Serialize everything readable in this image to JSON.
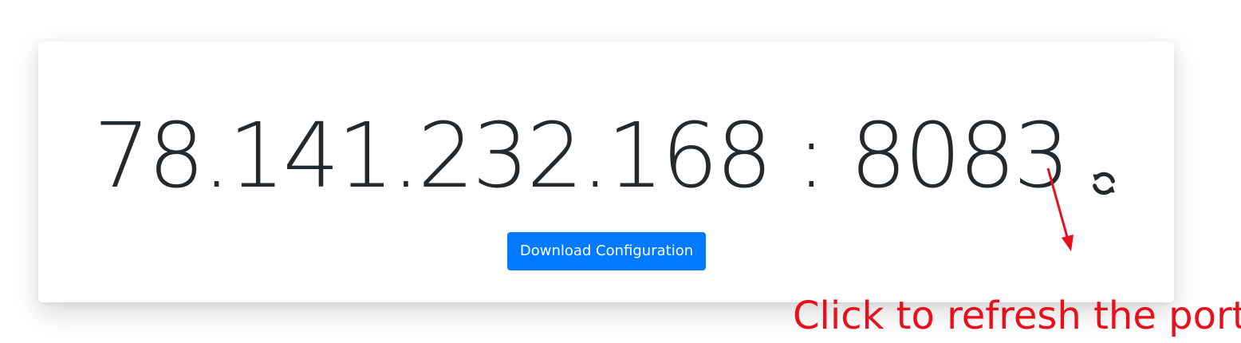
{
  "connection": {
    "address": "78.141.232.168 : 8083",
    "refresh_icon": "refresh-icon"
  },
  "actions": {
    "download_label": "Download Configuration"
  },
  "annotation": {
    "text": "Click to refresh the port",
    "color": "#e8101b"
  },
  "colors": {
    "button": "#007bff",
    "text": "#24292e"
  }
}
